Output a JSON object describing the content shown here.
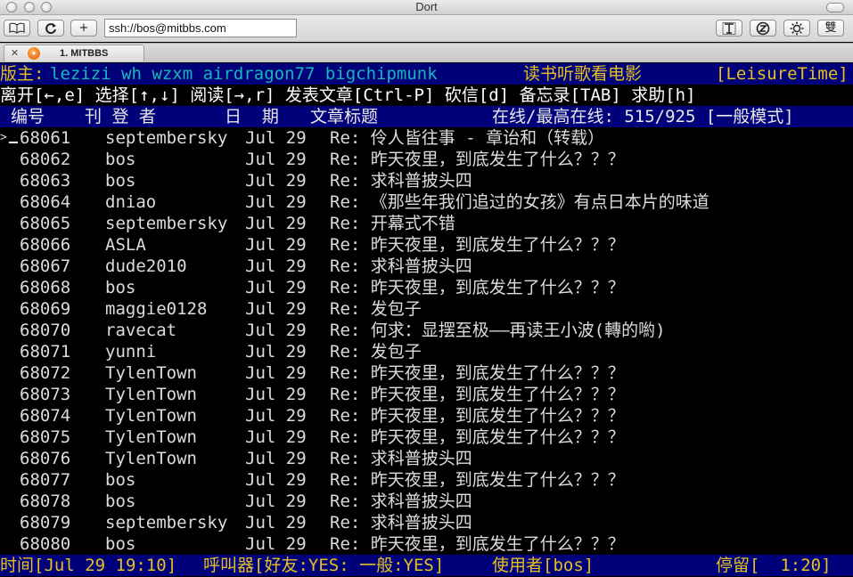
{
  "window": {
    "title": "Dort"
  },
  "toolbar": {
    "address": "ssh://bos@mitbbs.com",
    "buttons": [
      "bookmarks-icon",
      "reload-icon",
      "add-icon"
    ],
    "right_buttons": [
      "font-icon",
      "encoding-icon",
      "settings-icon",
      "convert-label"
    ],
    "convert_label": "雙"
  },
  "tabs": [
    {
      "label": "1. MITBBS"
    }
  ],
  "header": {
    "moderator_label": "版主:",
    "moderators": "lezizi wh wzxm airdragon77 bigchipmunk",
    "board_title": "读书听歌看电影",
    "board_name": "[LeisureTime]"
  },
  "help_line": "离开[←,e] 选择[↑,↓] 阅读[→,r] 发表文章[Ctrl-P] 砍信[d] 备忘录[TAB] 求助[h]",
  "columns": {
    "number": "编号",
    "author": "刊 登 者",
    "date": "日  期",
    "title": "文章标题",
    "online": "在线/最高在线: 515/925 [一般模式]"
  },
  "cursor_marker": ">",
  "rows": [
    {
      "num": "68061",
      "author": "septembersky",
      "date": "Jul 29",
      "title": "Re: 伶人皆往事 - 章诒和（转载）"
    },
    {
      "num": "68062",
      "author": "bos",
      "date": "Jul 29",
      "title": "Re: 昨天夜里，到底发生了什么？？？"
    },
    {
      "num": "68063",
      "author": "bos",
      "date": "Jul 29",
      "title": "Re: 求科普披头四"
    },
    {
      "num": "68064",
      "author": "dniao",
      "date": "Jul 29",
      "title": "Re: 《那些年我们追过的女孩》有点日本片的味道"
    },
    {
      "num": "68065",
      "author": "septembersky",
      "date": "Jul 29",
      "title": "Re: 开幕式不错"
    },
    {
      "num": "68066",
      "author": "ASLA",
      "date": "Jul 29",
      "title": "Re: 昨天夜里，到底发生了什么？？？"
    },
    {
      "num": "68067",
      "author": "dude2010",
      "date": "Jul 29",
      "title": "Re: 求科普披头四"
    },
    {
      "num": "68068",
      "author": "bos",
      "date": "Jul 29",
      "title": "Re: 昨天夜里，到底发生了什么？？？"
    },
    {
      "num": "68069",
      "author": "maggie0128",
      "date": "Jul 29",
      "title": "Re: 发包子"
    },
    {
      "num": "68070",
      "author": "ravecat",
      "date": "Jul 29",
      "title": "Re: 何求：显摆至极——再读王小波(轉的喲)"
    },
    {
      "num": "68071",
      "author": "yunni",
      "date": "Jul 29",
      "title": "Re: 发包子"
    },
    {
      "num": "68072",
      "author": "TylenTown",
      "date": "Jul 29",
      "title": "Re: 昨天夜里，到底发生了什么？？？"
    },
    {
      "num": "68073",
      "author": "TylenTown",
      "date": "Jul 29",
      "title": "Re: 昨天夜里，到底发生了什么？？？"
    },
    {
      "num": "68074",
      "author": "TylenTown",
      "date": "Jul 29",
      "title": "Re: 昨天夜里，到底发生了什么？？？"
    },
    {
      "num": "68075",
      "author": "TylenTown",
      "date": "Jul 29",
      "title": "Re: 昨天夜里，到底发生了什么？？？"
    },
    {
      "num": "68076",
      "author": "TylenTown",
      "date": "Jul 29",
      "title": "Re: 求科普披头四"
    },
    {
      "num": "68077",
      "author": "bos",
      "date": "Jul 29",
      "title": "Re: 昨天夜里，到底发生了什么？？？"
    },
    {
      "num": "68078",
      "author": "bos",
      "date": "Jul 29",
      "title": "Re: 求科普披头四"
    },
    {
      "num": "68079",
      "author": "septembersky",
      "date": "Jul 29",
      "title": "Re: 求科普披头四"
    },
    {
      "num": "68080",
      "author": "bos",
      "date": "Jul 29",
      "title": "Re: 昨天夜里，到底发生了什么？？？"
    }
  ],
  "status": {
    "time": "时间[Jul 29 19:10]",
    "pager": "呼叫器[好友:YES: 一般:YES]",
    "user": "使用者[bos]",
    "stay": "停留[  1:20]"
  },
  "colors": {
    "terminal_bg": "#000000",
    "bar_bg": "#00007b",
    "yellow": "#e6c020",
    "cyan": "#18b8b8"
  }
}
